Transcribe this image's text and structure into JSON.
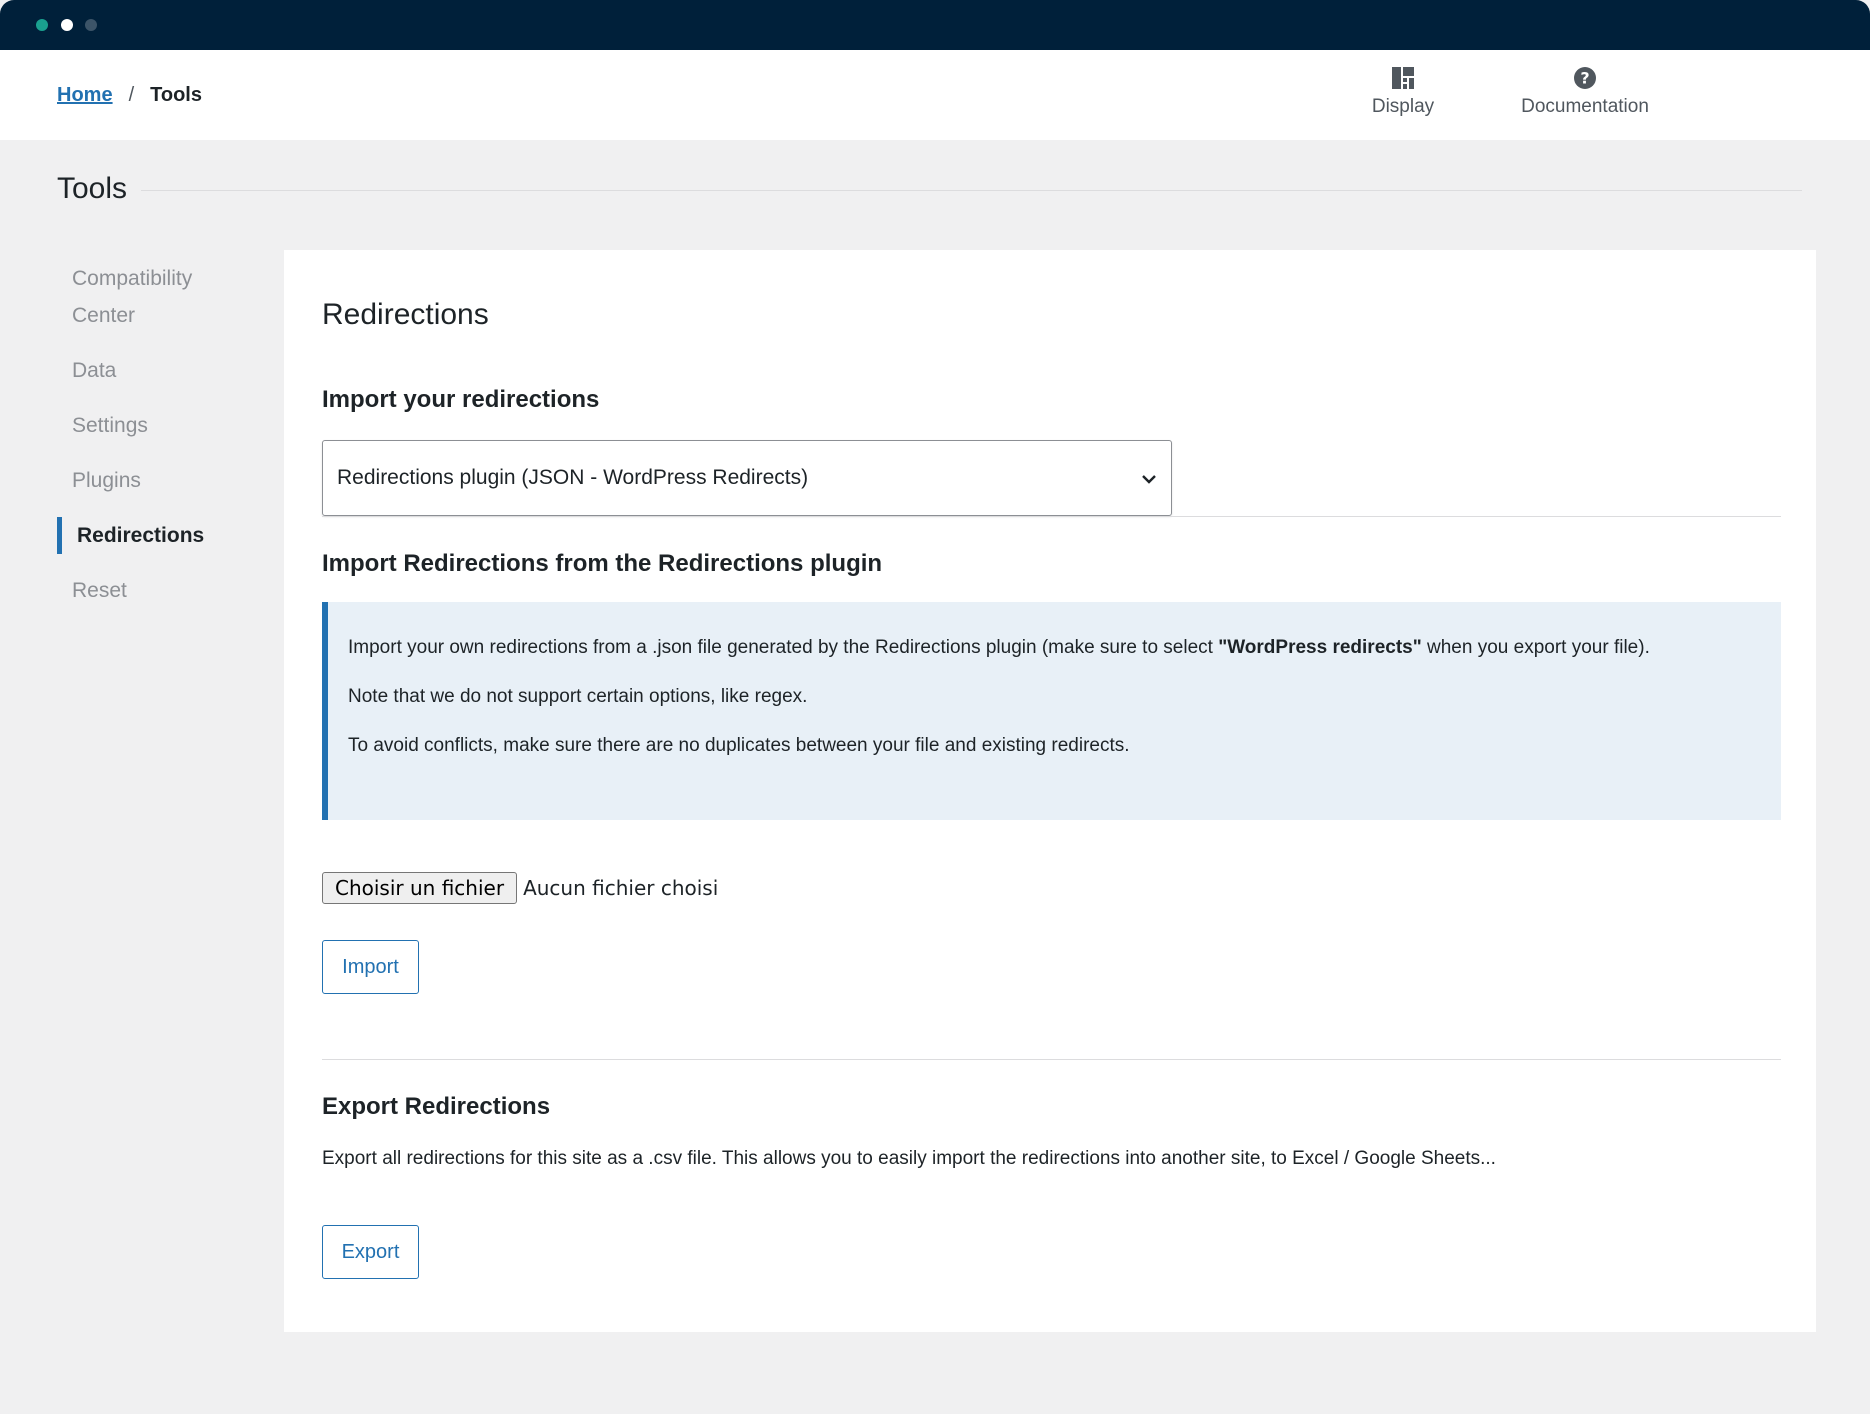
{
  "breadcrumb": {
    "home": "Home",
    "separator": "/",
    "current": "Tools"
  },
  "header_actions": {
    "display": "Display",
    "documentation": "Documentation"
  },
  "page": {
    "title": "Tools"
  },
  "sidebar": {
    "items": [
      {
        "label": "Compatibility"
      },
      {
        "label": "Center"
      },
      {
        "label": "Data"
      },
      {
        "label": "Settings"
      },
      {
        "label": "Plugins"
      },
      {
        "label": "Redirections"
      },
      {
        "label": "Reset"
      }
    ],
    "active": "Redirections"
  },
  "main": {
    "title": "Redirections",
    "import_heading": "Import your redirections",
    "import_source_selected": "Redirections plugin (JSON - WordPress Redirects)",
    "section_heading": "Import Redirections from the Redirections plugin",
    "notice": {
      "line1_before": "Import your own redirections from a .json file generated by the Redirections plugin (make sure to select ",
      "line1_bold": "\"WordPress redirects\"",
      "line1_after": " when you export your file).",
      "line2": "Note that we do not support certain options, like regex.",
      "line3": "To avoid conflicts, make sure there are no duplicates between your file and existing redirects."
    },
    "file_button": "Choisir un fichier",
    "file_status": "Aucun fichier choisi",
    "import_button": "Import",
    "export_heading": "Export Redirections",
    "export_description": "Export all redirections for this site as a .csv file. This allows you to easily import the redirections into another site, to Excel / Google Sheets...",
    "export_button": "Export"
  },
  "colors": {
    "accent": "#2271b1",
    "chrome": "#00203a",
    "notice_bg": "#e8f0f7",
    "page_bg": "#f0f0f1"
  },
  "icons": [
    "display-icon",
    "help-icon",
    "chevron-down-icon"
  ]
}
